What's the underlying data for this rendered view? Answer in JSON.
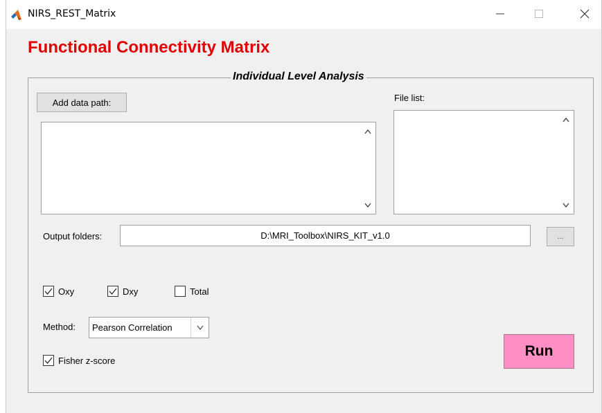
{
  "window": {
    "title": "NIRS_REST_Matrix",
    "app_icon": "matlab-icon",
    "controls": {
      "minimize": "minimize-icon",
      "maximize": "maximize-icon",
      "close": "close-icon"
    }
  },
  "main": {
    "heading": "Functional Connectivity Matrix",
    "heading_color": "#e00000"
  },
  "panel": {
    "title": "Individual Level Analysis",
    "add_data_label": "Add data path:",
    "file_list_label": "File list:",
    "output_label": "Output folders:",
    "output_value": "D:\\MRI_Toolbox\\NIRS_KIT_v1.0",
    "browse_label": "...",
    "checkboxes": {
      "oxy": {
        "label": "Oxy",
        "checked": true
      },
      "dxy": {
        "label": "Dxy",
        "checked": true
      },
      "total": {
        "label": "Total",
        "checked": false
      },
      "fisher": {
        "label": "Fisher z-score",
        "checked": true
      }
    },
    "method_label": "Method:",
    "method_value": "Pearson Correlation",
    "run_label": "Run",
    "run_color": "#ff8fc4"
  }
}
